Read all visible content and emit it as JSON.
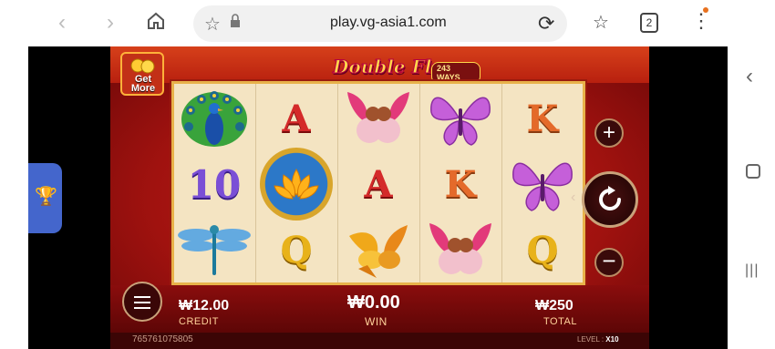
{
  "browser": {
    "url": "play.vg-asia1.com",
    "tabs_count": "2"
  },
  "game": {
    "title": "Double Fly",
    "ways": "243 WAYS",
    "get_more": "Get More",
    "reels": [
      [
        "peacock",
        "10",
        "dragonfly"
      ],
      [
        "A",
        "lotus-wild",
        "Q"
      ],
      [
        "doves",
        "A",
        "birds"
      ],
      [
        "butterfly",
        "K",
        "doves"
      ],
      [
        "K",
        "butterfly",
        "Q"
      ]
    ],
    "credit_value": "₩12.00",
    "credit_label": "CREDIT",
    "win_value": "₩0.00",
    "win_label": "WIN",
    "total_value": "₩250",
    "total_label": "TOTAL",
    "account_id": "765761075805",
    "level_label": "LEVEL :",
    "level_value": "X10"
  },
  "colors": {
    "brand_red": "#c8201b",
    "gold": "#e8b24a"
  }
}
